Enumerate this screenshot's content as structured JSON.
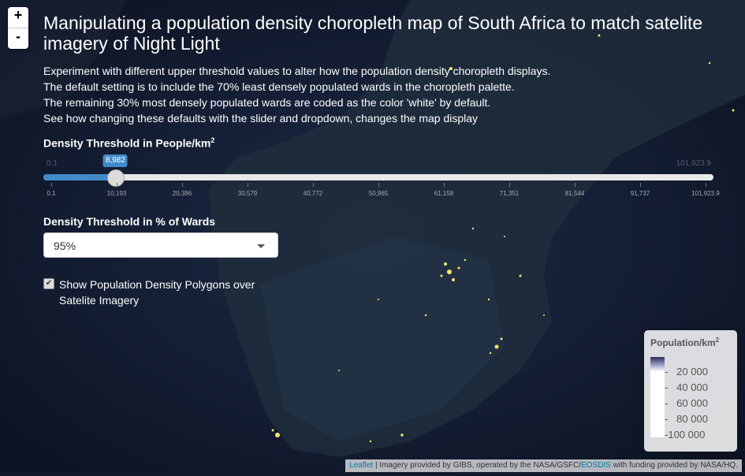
{
  "zoom": {
    "in": "+",
    "out": "-"
  },
  "title": "Manipulating a population density choropleth map of South Africa to match satelite imagery of Night Light",
  "desc": [
    "Experiment with different upper threshold values to alter how the population density choropleth displays.",
    "The default setting is to include the 70% least densely populated wards in the choropleth palette.",
    "The remaining 30% most densely populated wards are coded as the color 'white' by default.",
    "See how changing these defaults with the slider and dropdown, changes the map display"
  ],
  "slider": {
    "label": "Density Threshold in People/km",
    "label_sup": "2",
    "min": "0.1",
    "max": "101,923.9",
    "value_label": "8,982",
    "value_fraction": 0.0981,
    "ticks": [
      "0.1",
      "10,193",
      "20,386",
      "30,579",
      "40,772",
      "50,965",
      "61,158",
      "71,351",
      "81,544",
      "91,737",
      "101,923.9"
    ]
  },
  "select": {
    "label": "Density Threshold in % of Wards",
    "value": "95%"
  },
  "checkbox": {
    "label": "Show Population Density Polygons over Satelite Imagery",
    "checked": true,
    "mark": "✔"
  },
  "legend": {
    "title": "Population/km",
    "title_sup": "2",
    "levels": [
      "20 000",
      "40 000",
      "60 000",
      "80 000",
      "100 000"
    ]
  },
  "attribution": {
    "leaflet": "Leaflet",
    "text1": " | Imagery provided by GIBS, operated by the NASA/GSFC/",
    "eosdis": "EOSDIS",
    "text2": " with funding provided by NASA/HQ."
  }
}
